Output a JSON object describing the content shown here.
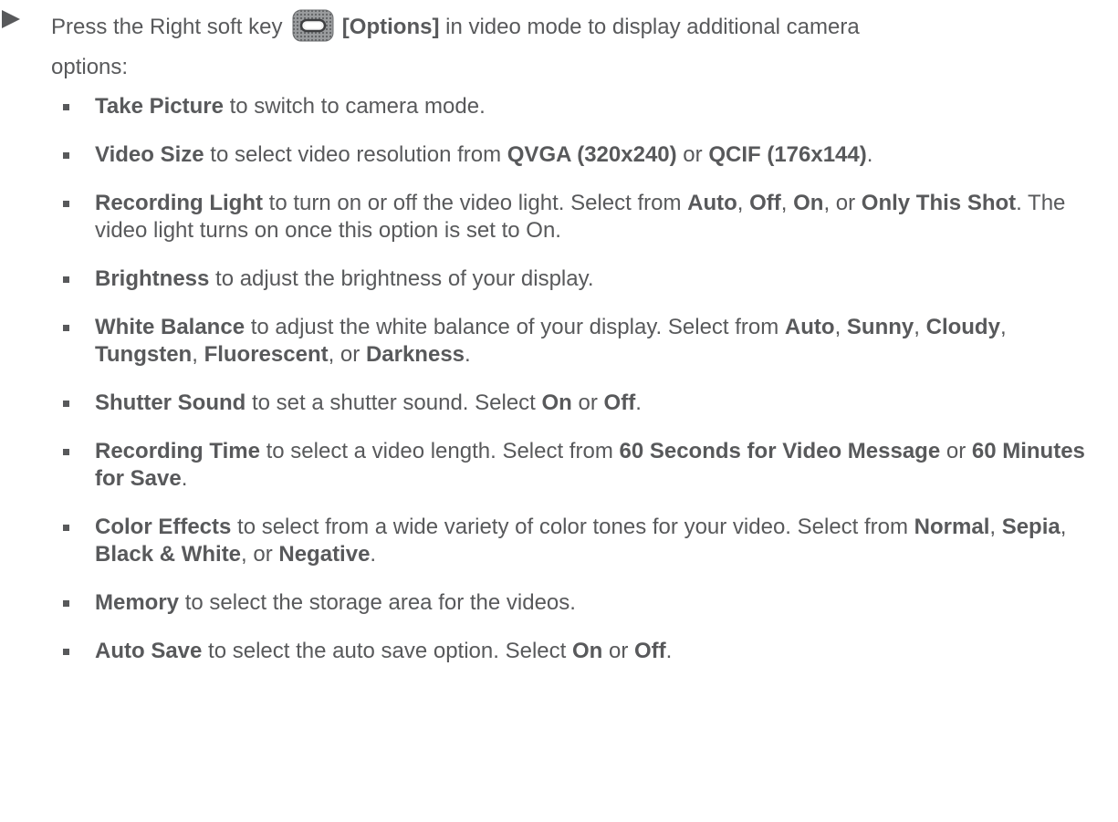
{
  "intro": {
    "pre": "Press the Right soft key",
    "key": "[Options]",
    "post_line1": " in video mode to display additional camera",
    "post_line2": "options:",
    "icon": "right-softkey-icon"
  },
  "options": [
    {
      "name": "Take Picture",
      "t1": " to switch to camera mode."
    },
    {
      "name": "Video Size",
      "t1": " to select video resolution from ",
      "b1": "QVGA (320x240)",
      "t2": " or ",
      "b2": "QCIF (176x144)",
      "t3": "."
    },
    {
      "name": "Recording Light",
      "t1": " to turn on or off the video light. Select from ",
      "b1": "Auto",
      "t2": ", ",
      "b2": "Off",
      "t3": ", ",
      "b3": "On",
      "t4": ", or ",
      "b4": "Only This Shot",
      "t5": ". The video light turns on once this option is set to On."
    },
    {
      "name": "Brightness",
      "t1": " to adjust the brightness of your display."
    },
    {
      "name": "White Balance",
      "t1": " to adjust the white balance of your display. Select from ",
      "b1": "Auto",
      "t2": ", ",
      "b2": "Sunny",
      "t3": ", ",
      "b3": "Cloudy",
      "t4": ", ",
      "b4": "Tungsten",
      "t5": ", ",
      "b5": "Fluorescent",
      "t6": ", or ",
      "b6": "Darkness",
      "t7": "."
    },
    {
      "name": "Shutter Sound",
      "t1": " to set a shutter sound. Select ",
      "b1": "On",
      "t2": " or ",
      "b2": "Off",
      "t3": "."
    },
    {
      "name": "Recording Time",
      "t1": " to select a video length. Select from ",
      "b1": "60 Seconds for Video Message",
      "t2": " or ",
      "b2": "60 Minutes for Save",
      "t3": "."
    },
    {
      "name": "Color Effects",
      "t1": " to select from a wide variety of color tones for your video. Select from ",
      "b1": "Normal",
      "t2": ", ",
      "b2": "Sepia",
      "t3": ", ",
      "b3": "Black & White",
      "t4": ", or ",
      "b4": "Negative",
      "t5": "."
    },
    {
      "name": "Memory",
      "t1": " to select the storage area for the videos."
    },
    {
      "name": "Auto Save",
      "t1": " to select the auto save option. Select ",
      "b1": "On",
      "t2": " or ",
      "b2": "Off",
      "t3": "."
    }
  ],
  "colors": {
    "text": "#58595b",
    "icon_outer": "#8a8c8e",
    "icon_inner": "#3e3f41"
  }
}
